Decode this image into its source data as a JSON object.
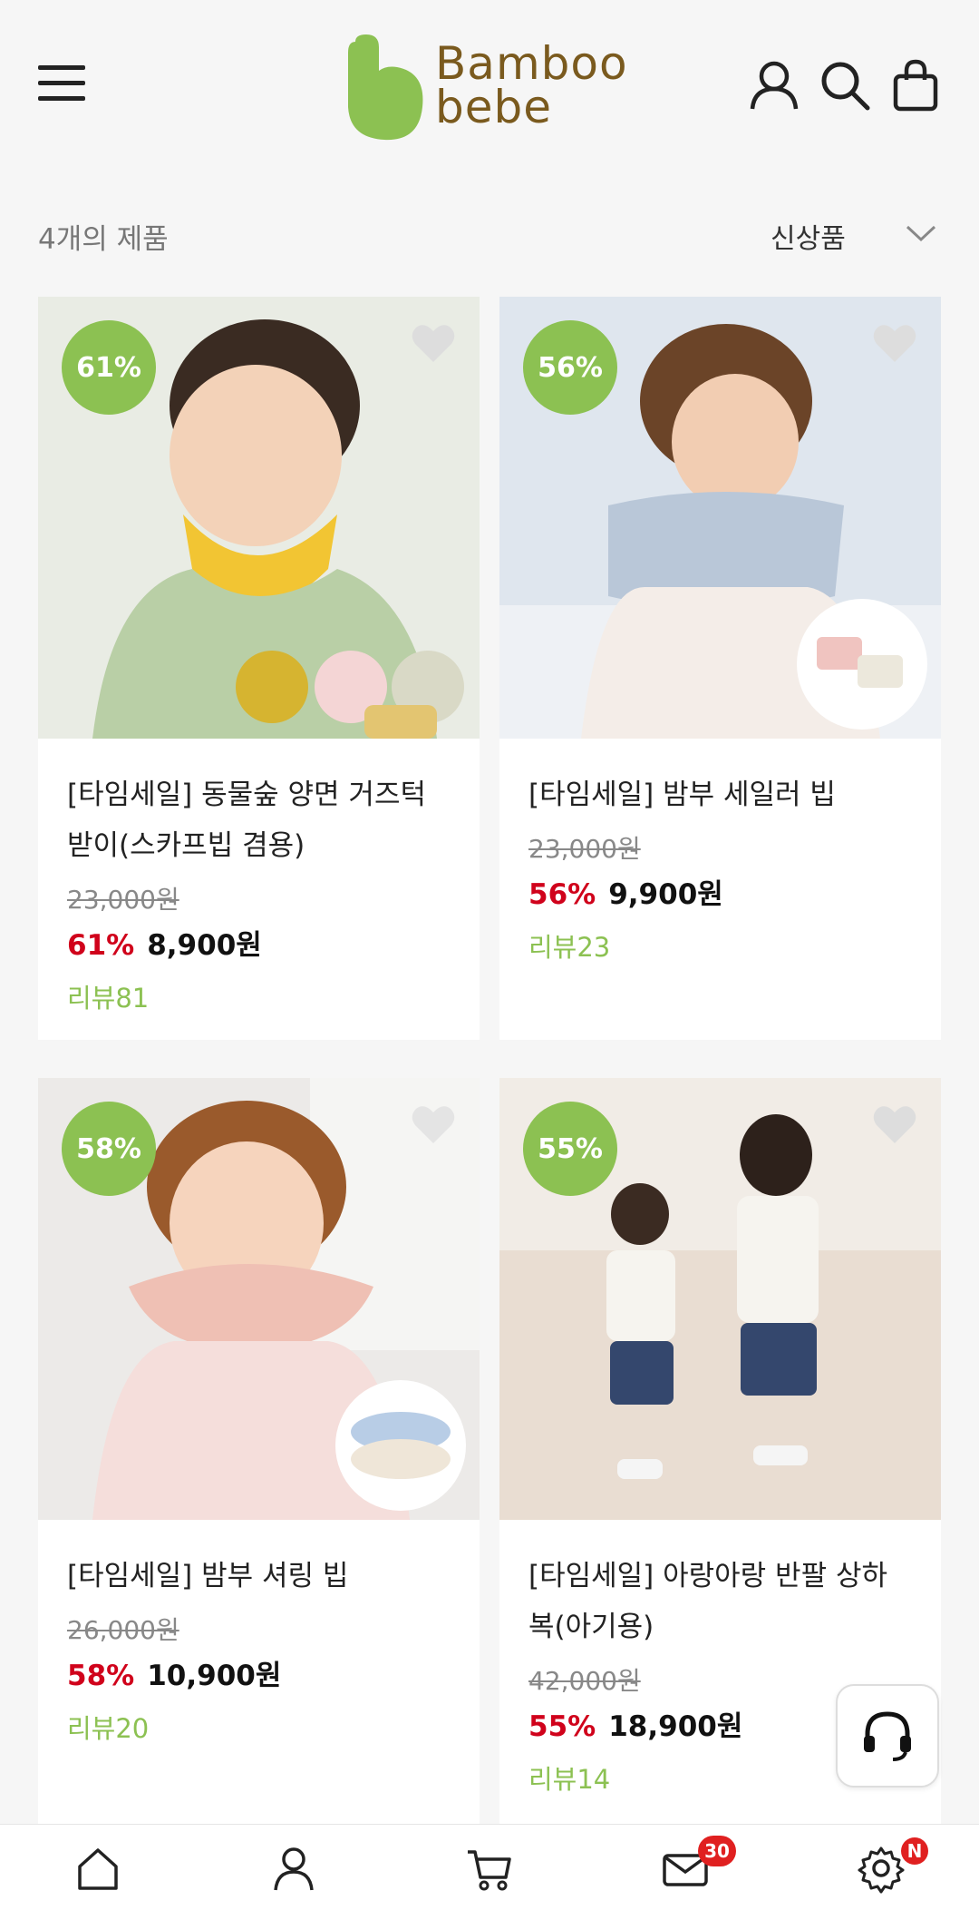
{
  "header": {
    "logo_line1": "Bamboo",
    "logo_line2": "bebe",
    "icons": [
      "menu-icon",
      "user-icon",
      "search-icon",
      "shopping-bag-icon"
    ]
  },
  "toolbar": {
    "count_text": "4개의 제품",
    "sort_label": "신상품"
  },
  "products": [
    {
      "discount_badge": "61%",
      "title": "[타임세일] 동물숲 양면 거즈턱받이(스카프빕 겸용)",
      "original_price": "23,000원",
      "discount_rate": "61%",
      "sale_price": "8,900원",
      "review": "리뷰81"
    },
    {
      "discount_badge": "56%",
      "title": "[타임세일] 밤부 세일러 빕",
      "original_price": "23,000원",
      "discount_rate": "56%",
      "sale_price": "9,900원",
      "review": "리뷰23"
    },
    {
      "discount_badge": "58%",
      "title": "[타임세일] 밤부 셔링 빕",
      "original_price": "26,000원",
      "discount_rate": "58%",
      "sale_price": "10,900원",
      "review": "리뷰20"
    },
    {
      "discount_badge": "55%",
      "title": "[타임세일] 아랑아랑 반팔 상하복(아기용)",
      "original_price": "42,000원",
      "discount_rate": "55%",
      "sale_price": "18,900원",
      "review": "리뷰14"
    }
  ],
  "bottom_nav": {
    "items": [
      "home-icon",
      "user-icon",
      "cart-icon",
      "mail-icon",
      "settings-icon"
    ],
    "mail_badge": "30",
    "settings_badge": "N"
  },
  "colors": {
    "brand_green": "#8cc152",
    "logo_brown": "#7a5a1e",
    "discount_red": "#d0021b"
  }
}
